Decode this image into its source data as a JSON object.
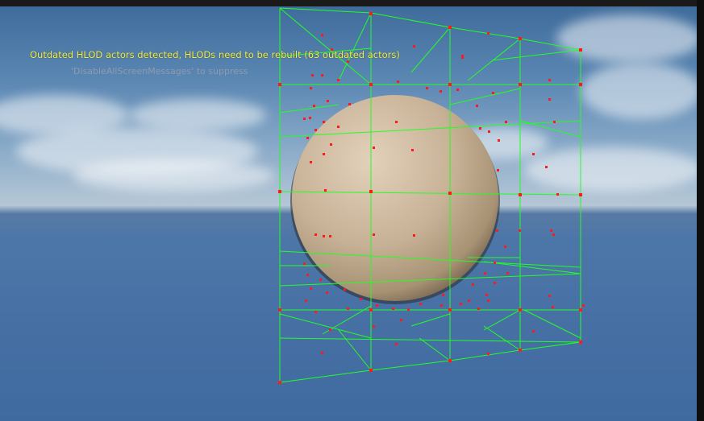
{
  "viewport": {
    "warning_message": "Outdated HLOD actors detected, HLODs need to be rebuilt (63 outdated actors)",
    "suppress_hint": "'DisableAllScreenMessages' to suppress"
  },
  "colors": {
    "warning_text": "#f0f04a",
    "hint_text": "#8d9cb0",
    "wireframe": "#22ff22",
    "vertex_marker": "#ff1a1a",
    "sphere": "#c9b49a"
  }
}
